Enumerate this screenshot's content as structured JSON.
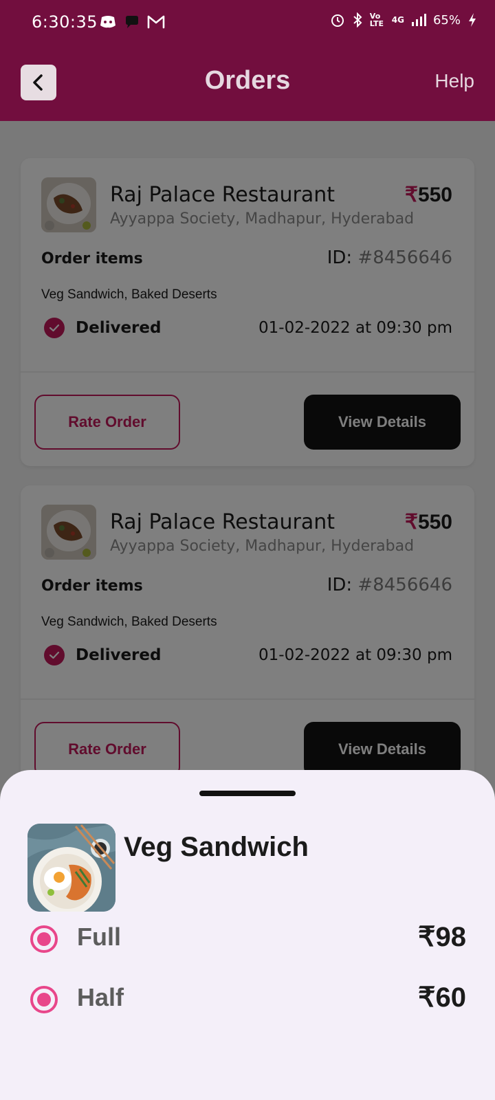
{
  "status_bar": {
    "time": "6:30:35",
    "battery": "65%",
    "network": "4G",
    "volte": "Vo LTE"
  },
  "app_bar": {
    "title": "Orders",
    "help_label": "Help"
  },
  "orders": [
    {
      "restaurant": "Raj Palace Restaurant",
      "address": "Ayyappa Society, Madhapur, Hyderabad",
      "currency": "₹",
      "price": "550",
      "order_items_label": "Order items",
      "id_label": "ID:",
      "id_value": "#8456646",
      "items": "Veg Sandwich, Baked Deserts",
      "status": "Delivered",
      "datetime": "01-02-2022 at 09:30 pm",
      "rate_label": "Rate Order",
      "view_label": "View Details"
    },
    {
      "restaurant": "Raj Palace Restaurant",
      "address": "Ayyappa Society, Madhapur, Hyderabad",
      "currency": "₹",
      "price": "550",
      "order_items_label": "Order items",
      "id_label": "ID:",
      "id_value": "#8456646",
      "items": "Veg Sandwich, Baked Deserts",
      "status": "Delivered",
      "datetime": "01-02-2022 at 09:30 pm",
      "rate_label": "Rate Order",
      "view_label": "View Details"
    }
  ],
  "sheet": {
    "title": "Veg Sandwich",
    "options": [
      {
        "label": "Full",
        "price": "₹98",
        "selected": true
      },
      {
        "label": "Half",
        "price": "₹60",
        "selected": true
      }
    ]
  },
  "colors": {
    "brand": "#720e3e",
    "accent": "#c2185b",
    "radio": "#e8468a",
    "sheet_bg": "#f4eff9"
  },
  "icons": {
    "back": "chevron-left-icon",
    "check": "check-circle-icon",
    "alarm": "alarm-icon",
    "bluetooth": "bluetooth-icon",
    "signal": "signal-icon",
    "battery": "battery-charging-icon"
  }
}
